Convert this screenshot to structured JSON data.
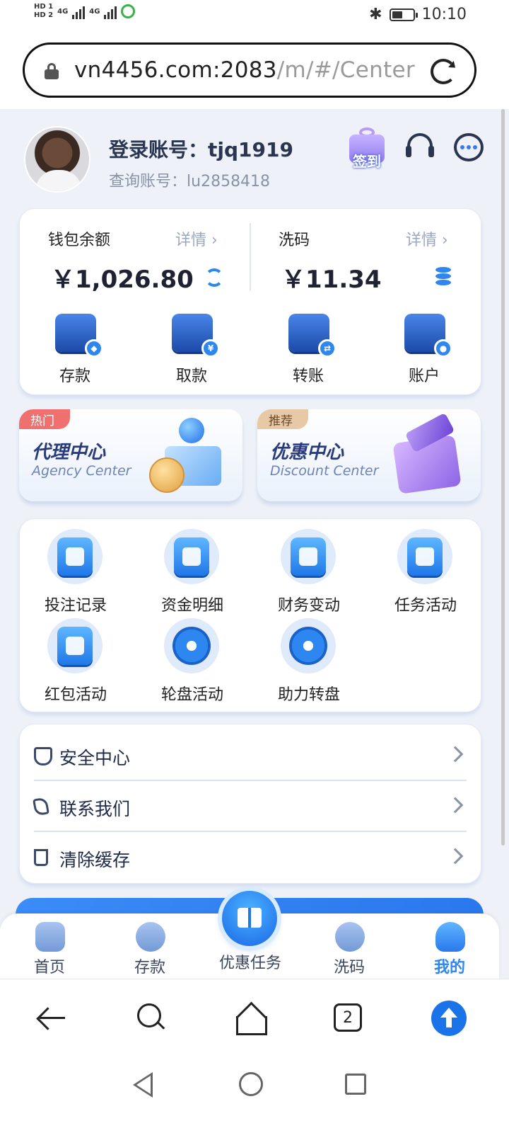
{
  "status_bar": {
    "hd1": "HD 1",
    "hd2": "HD 2",
    "net1": "4G",
    "net2": "4G",
    "time": "10:10"
  },
  "browser": {
    "url_host": "vn4456.com:2083",
    "url_path": "/m/#/Center",
    "tab_count": "2"
  },
  "profile": {
    "login_label": "登录账号：",
    "login_account": "tjq1919",
    "query_label": "查询账号：",
    "query_account": "lu2858418",
    "signin_label": "签到"
  },
  "wallet": {
    "balance_label": "钱包余额",
    "balance_detail": "详情 ›",
    "balance_amount": "￥1,026.80",
    "rebate_label": "洗码",
    "rebate_detail": "详情 ›",
    "rebate_amount": "￥11.34",
    "actions": [
      {
        "label": "存款",
        "icon": "wallet-deposit-icon"
      },
      {
        "label": "取款",
        "icon": "card-withdraw-icon"
      },
      {
        "label": "转账",
        "icon": "transfer-icon"
      },
      {
        "label": "账户",
        "icon": "account-icon"
      }
    ]
  },
  "promos": [
    {
      "tag": "热门",
      "title": "代理中心",
      "subtitle": "Agency Center"
    },
    {
      "tag": "推荐",
      "title": "优惠中心",
      "subtitle": "Discount Center"
    }
  ],
  "features": [
    {
      "label": "投注记录",
      "icon": "bet-record-icon"
    },
    {
      "label": "资金明细",
      "icon": "fund-detail-icon"
    },
    {
      "label": "财务变动",
      "icon": "finance-change-icon"
    },
    {
      "label": "任务活动",
      "icon": "task-activity-icon"
    },
    {
      "label": "红包活动",
      "icon": "red-packet-icon"
    },
    {
      "label": "轮盘活动",
      "icon": "roulette-icon"
    },
    {
      "label": "助力转盘",
      "icon": "assist-wheel-icon"
    }
  ],
  "menu": [
    {
      "label": "安全中心",
      "icon": "shield-icon"
    },
    {
      "label": "联系我们",
      "icon": "phone-icon"
    },
    {
      "label": "清除缓存",
      "icon": "trash-icon"
    }
  ],
  "bottom_nav": [
    {
      "label": "首页",
      "icon": "home-icon"
    },
    {
      "label": "存款",
      "icon": "deposit-icon"
    },
    {
      "label": "优惠任务",
      "icon": "gift-icon"
    },
    {
      "label": "洗码",
      "icon": "rebate-icon"
    },
    {
      "label": "我的",
      "icon": "user-icon"
    }
  ],
  "colors": {
    "accent": "#2e86f0",
    "page_bg": "#eef2f8",
    "hot_tag": "#f07070",
    "recommend_tag": "#e8c9a6"
  }
}
